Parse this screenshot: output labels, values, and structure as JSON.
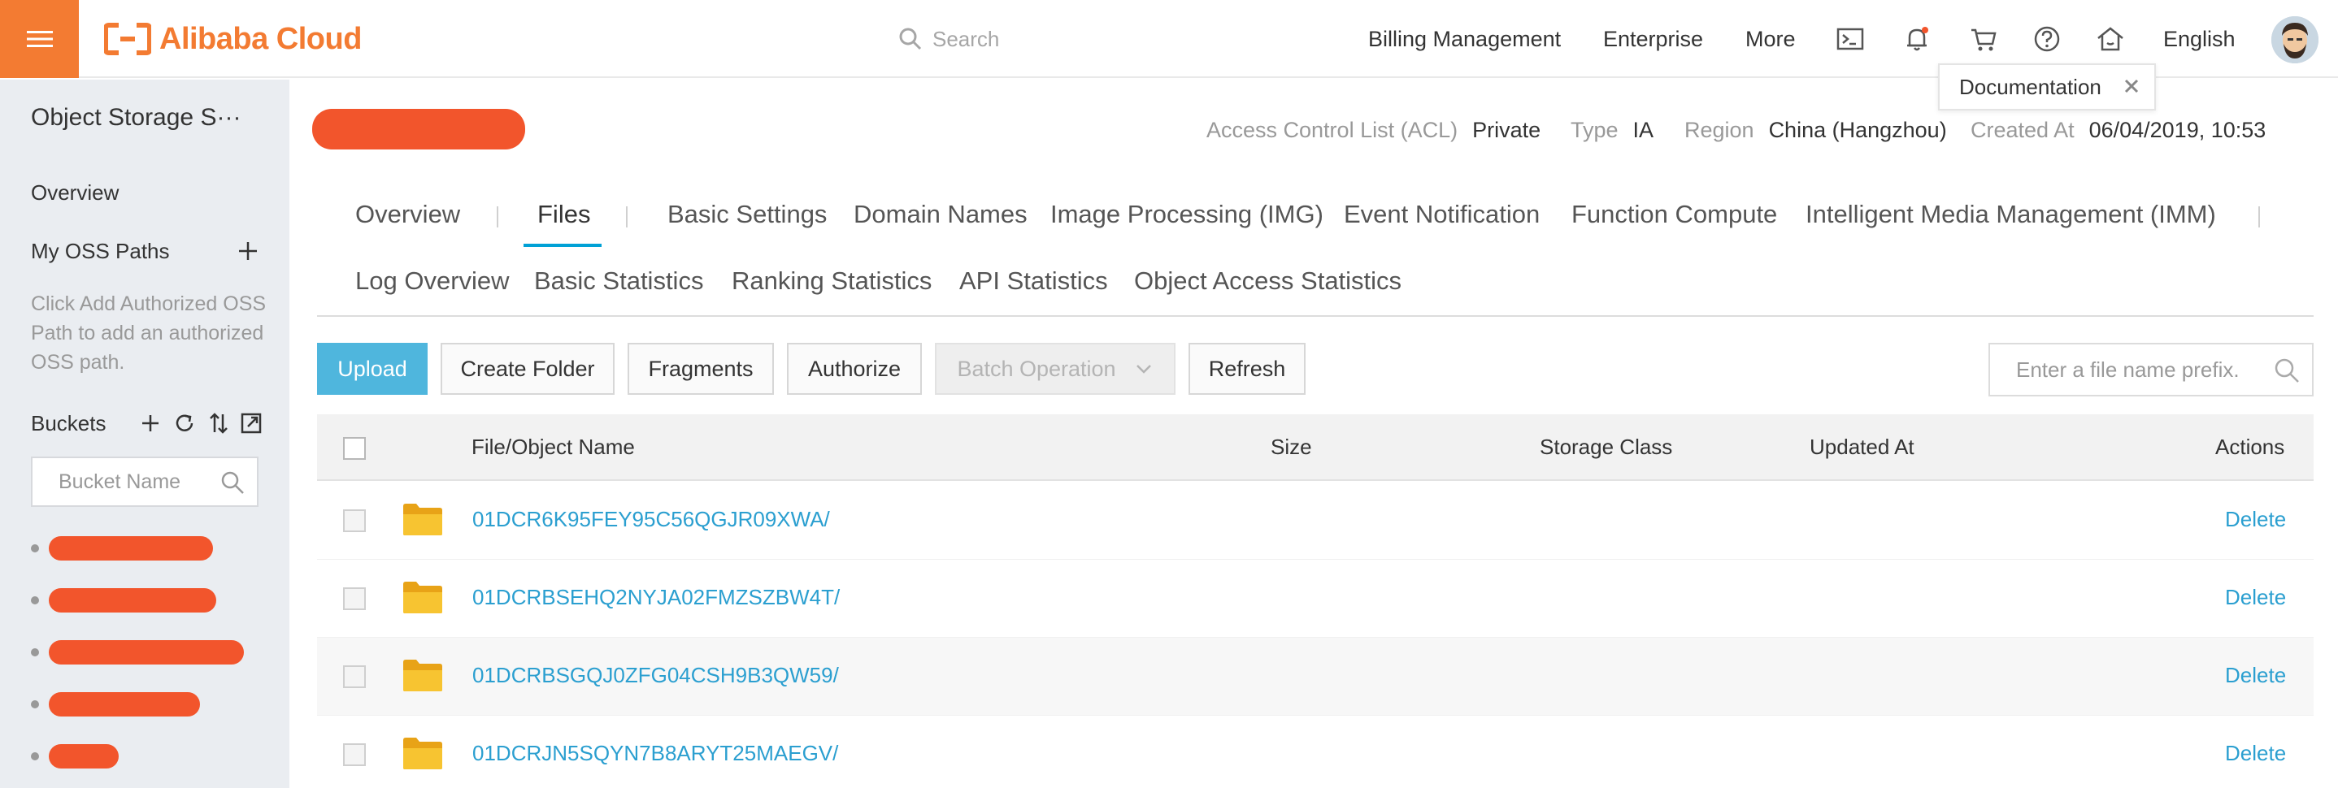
{
  "header": {
    "brand": "Alibaba Cloud",
    "search_placeholder": "Search",
    "nav": [
      "Billing Management",
      "Enterprise",
      "More"
    ],
    "language": "English",
    "tooltip": "Documentation",
    "icons": [
      "terminal-icon",
      "bell-icon",
      "cart-icon",
      "help-icon",
      "home-icon"
    ],
    "accent_color": "#f37b32"
  },
  "sidebar": {
    "title": "Object Storage S···",
    "overview": "Overview",
    "my_oss_paths": "My OSS Paths",
    "note": "Click Add Authorized OSS Path to add an authorized OSS path.",
    "buckets_label": "Buckets",
    "bucket_search_placeholder": "Bucket Name"
  },
  "bucket_info": {
    "acl_label": "Access Control List (ACL)",
    "acl_value": "Private",
    "type_label": "Type",
    "type_value": "IA",
    "region_label": "Region",
    "region_value": "China (Hangzhou)",
    "created_label": "Created At",
    "created_value": "06/04/2019, 10:53"
  },
  "tabs": {
    "row1": [
      "Overview",
      "Files",
      "Basic Settings",
      "Domain Names",
      "Image Processing (IMG)",
      "Event Notification",
      "Function Compute",
      "Intelligent Media Management (IMM)"
    ],
    "row2": [
      "Log Overview",
      "Basic Statistics",
      "Ranking Statistics",
      "API Statistics",
      "Object Access Statistics"
    ],
    "active": "Files"
  },
  "toolbar": {
    "upload": "Upload",
    "create_folder": "Create Folder",
    "fragments": "Fragments",
    "authorize": "Authorize",
    "batch_operation": "Batch Operation",
    "refresh": "Refresh",
    "file_search_placeholder": "Enter a file name prefix."
  },
  "table": {
    "columns": [
      "File/Object Name",
      "Size",
      "Storage Class",
      "Updated At",
      "Actions"
    ],
    "rows": [
      {
        "name": "01DCR6K95FEY95C56QGJR09XWA/",
        "action": "Delete"
      },
      {
        "name": "01DCRBSEHQ2NYJA02FMZSZBW4T/",
        "action": "Delete"
      },
      {
        "name": "01DCRBSGQJ0ZFG04CSH9B3QW59/",
        "action": "Delete"
      },
      {
        "name": "01DCRJN5SQYN7B8ARYT25MAEGV/",
        "action": "Delete"
      }
    ],
    "link_color": "#2b9fd0"
  }
}
